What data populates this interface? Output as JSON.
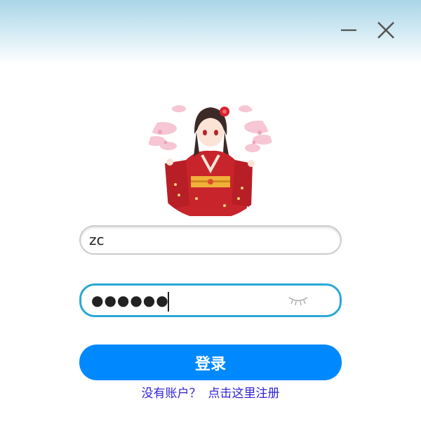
{
  "window": {
    "title_bar_gradient": [
      "#aad6e8",
      "#ffffff"
    ],
    "minimize_icon": "minimize-icon",
    "close_icon": "close-icon"
  },
  "avatar": {
    "icon": "anime-girl-avatar"
  },
  "login_form": {
    "username": {
      "value": "zc"
    },
    "password": {
      "masked_value": "●●●●●●●●",
      "eye_icon": "eye-closed-icon"
    },
    "submit_label": "登录",
    "register_prompt": "没有账户？",
    "register_link": "点击这里注册"
  },
  "colors": {
    "accent": "#0089ff",
    "focus_border": "#2ba7d6",
    "link": "#2f22d6",
    "field_border": "#cccccc"
  }
}
